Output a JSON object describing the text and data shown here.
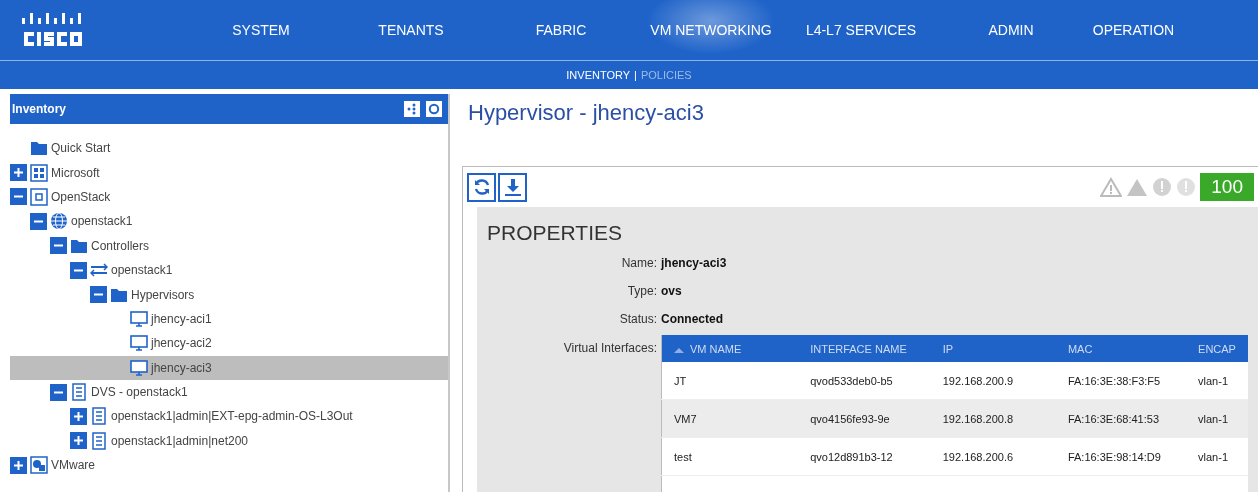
{
  "nav": {
    "tabs": [
      {
        "label": "SYSTEM",
        "selected": false
      },
      {
        "label": "TENANTS",
        "selected": false
      },
      {
        "label": "FABRIC",
        "selected": false
      },
      {
        "label": "VM NETWORKING",
        "selected": true
      },
      {
        "label": "L4-L7 SERVICES",
        "selected": false
      },
      {
        "label": "ADMIN",
        "selected": false
      },
      {
        "label": "OPERATION",
        "selected": false
      }
    ],
    "subtabs": [
      {
        "label": "INVENTORY",
        "selected": true
      },
      {
        "label": "POLICIES",
        "selected": false
      }
    ],
    "separator": "|"
  },
  "sidebar": {
    "title": "Inventory",
    "tree": [
      {
        "label": "Quick Start",
        "kind": "folder",
        "selected": false
      },
      {
        "label": "Microsoft",
        "kind": "grid",
        "expanded": false,
        "selected": false
      },
      {
        "label": "OpenStack",
        "kind": "stack",
        "expanded": true,
        "selected": false,
        "children": [
          {
            "label": "openstack1",
            "kind": "globe",
            "expanded": true,
            "selected": false,
            "children": [
              {
                "label": "Controllers",
                "kind": "folder",
                "expanded": true,
                "selected": false,
                "children": [
                  {
                    "label": "openstack1",
                    "kind": "switch",
                    "expanded": true,
                    "selected": false,
                    "children": [
                      {
                        "label": "Hypervisors",
                        "kind": "folder",
                        "expanded": true,
                        "selected": false,
                        "children": [
                          {
                            "label": "jhency-aci1",
                            "kind": "monitor",
                            "selected": false
                          },
                          {
                            "label": "jhency-aci2",
                            "kind": "monitor",
                            "selected": false
                          },
                          {
                            "label": "jhency-aci3",
                            "kind": "monitor",
                            "selected": true
                          }
                        ]
                      }
                    ]
                  }
                ]
              },
              {
                "label": "DVS - openstack1",
                "kind": "server",
                "expanded": true,
                "selected": false,
                "children": [
                  {
                    "label": "openstack1|admin|EXT-epg-admin-OS-L3Out",
                    "kind": "server",
                    "expanded": false,
                    "selected": false
                  },
                  {
                    "label": "openstack1|admin|net200",
                    "kind": "server",
                    "expanded": false,
                    "selected": false
                  }
                ]
              }
            ]
          }
        ]
      },
      {
        "label": "VMware",
        "kind": "vmware",
        "expanded": false,
        "selected": false
      }
    ]
  },
  "content": {
    "title": "Hypervisor - jhency-aci3",
    "health": "100",
    "properties_title": "PROPERTIES",
    "properties": [
      {
        "label": "Name:",
        "value": "jhency-aci3"
      },
      {
        "label": "Type:",
        "value": "ovs"
      },
      {
        "label": "Status:",
        "value": "Connected"
      }
    ],
    "interfaces_label": "Virtual Interfaces:",
    "table": {
      "columns": [
        {
          "label": "VM NAME",
          "sorted": true
        },
        {
          "label": "INTERFACE NAME",
          "sorted": false
        },
        {
          "label": "IP",
          "sorted": false
        },
        {
          "label": "MAC",
          "sorted": false
        },
        {
          "label": "ENCAP",
          "sorted": false
        }
      ],
      "rows": [
        [
          "JT",
          "qvod533deb0-b5",
          "192.168.200.9",
          "FA:16:3E:38:F3:F5",
          "vlan-1"
        ],
        [
          "VM7",
          "qvo4156fe93-9e",
          "192.168.200.8",
          "FA:16:3E:68:41:53",
          "vlan-1"
        ],
        [
          "test",
          "qvo12d891b3-12",
          "192.168.200.6",
          "FA:16:3E:98:14:D9",
          "vlan-1"
        ]
      ]
    }
  }
}
